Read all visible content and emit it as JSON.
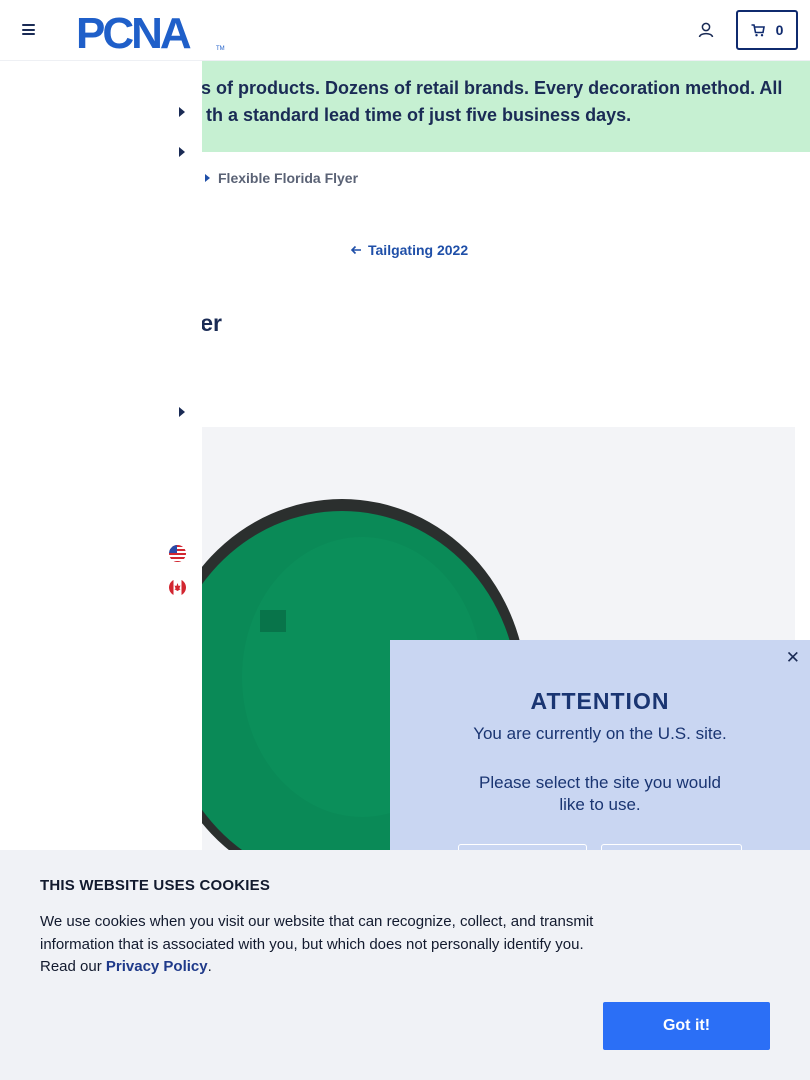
{
  "header": {
    "logo_text": "PCNA",
    "logo_tm": "TM",
    "cart_count": "0"
  },
  "banner": {
    "line1": "ls of products. Dozens of retail brands. Every decoration method. All",
    "line2": "th a standard lead time of just five business days."
  },
  "breadcrumb": {
    "current": "Flexible Florida Flyer"
  },
  "back_link": {
    "label": "Tailgating 2022"
  },
  "product": {
    "title_fragment": "Flyer"
  },
  "attention_modal": {
    "title": "ATTENTION",
    "line1": "You are currently on the U.S. site.",
    "line2": "Please select the site you would like to use.",
    "close": "✕"
  },
  "cookie_banner": {
    "title": "THIS WEBSITE USES COOKIES",
    "text": "We use cookies when you visit our website that can recognize, collect, and transmit information that is associated with you, but which does not personally identify you. Read our ",
    "link": "Privacy Policy",
    "period": ".",
    "button": "Got it!"
  },
  "colors": {
    "brand_navy": "#1a2b55",
    "banner_green": "#c6f0d2",
    "modal_blue": "#c9d6f2",
    "button_blue": "#2b6ff6",
    "product_green": "#0a8a57"
  },
  "icons": [
    "hamburger-icon",
    "account-icon",
    "cart-icon",
    "caret-right-icon",
    "arrow-left-icon",
    "us-flag-icon",
    "canada-flag-icon",
    "close-icon"
  ]
}
